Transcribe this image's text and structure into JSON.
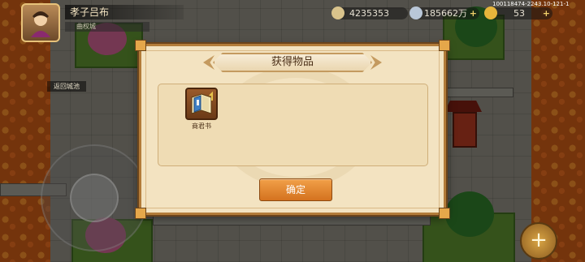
{
  "server_id": "100118474-2243.10-121-1",
  "player": {
    "name": "孝子吕布",
    "subtitle": "曲权城"
  },
  "resources": [
    {
      "icon": "ingot-icon",
      "value": "4235353"
    },
    {
      "icon": "silver-coin-icon",
      "value": "185662万"
    },
    {
      "icon": "gold-coin-icon",
      "value": "53"
    }
  ],
  "side_button": {
    "label": "返回城池"
  },
  "dialog": {
    "title": "获得物品",
    "items": [
      {
        "name": "商君书",
        "icon": "book-icon"
      }
    ],
    "confirm_label": "确定"
  },
  "colors": {
    "dialog_bg": "#f3e3c1",
    "button": "#e58a32",
    "accent_gold": "#e5a74a"
  }
}
